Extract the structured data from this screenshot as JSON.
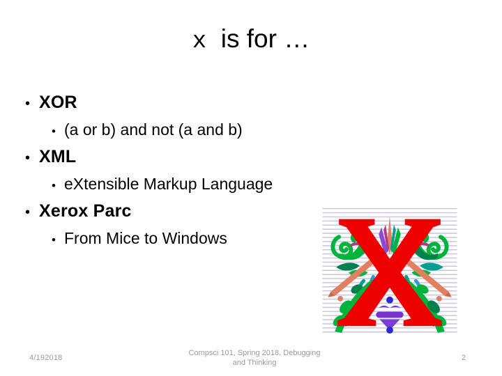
{
  "slide": {
    "title": {
      "letter": "x",
      "rest": "  is for …",
      "full": "x  is for …"
    },
    "bullets": [
      {
        "level": 1,
        "marker": "•",
        "text": "XOR"
      },
      {
        "level": 2,
        "marker": "•",
        "text": "(a or b) and not (a and b)"
      },
      {
        "level": 1,
        "marker": "•",
        "text": "XML"
      },
      {
        "level": 2,
        "marker": "•",
        "text": "eXtensible Markup Language"
      },
      {
        "level": 1,
        "marker": "•",
        "text": "Xerox Parc"
      },
      {
        "level": 2,
        "marker": "•",
        "text": "From Mice to Windows"
      }
    ],
    "decorative_image": {
      "name": "illuminated-letter-x",
      "letter": "X",
      "colors": {
        "letter_red": "#ee0000",
        "foliage_green": "#00b33c",
        "foliage_dark_green": "#00804a",
        "foliage_teal": "#009e8e",
        "accent_salmon": "#e08060",
        "accent_purple": "#7a2fd0",
        "accent_blue": "#2a2ad0",
        "accent_magenta": "#b03a8a",
        "hatch_line": "#b9aed6",
        "background": "#ffffff"
      }
    },
    "footer": {
      "date": "4/192018",
      "center_line1": "Compsci 101, Spring 2018, Debugging",
      "center_line2": "and Thinking",
      "slide_number": "2",
      "text_color": "#9b9b9b"
    }
  }
}
